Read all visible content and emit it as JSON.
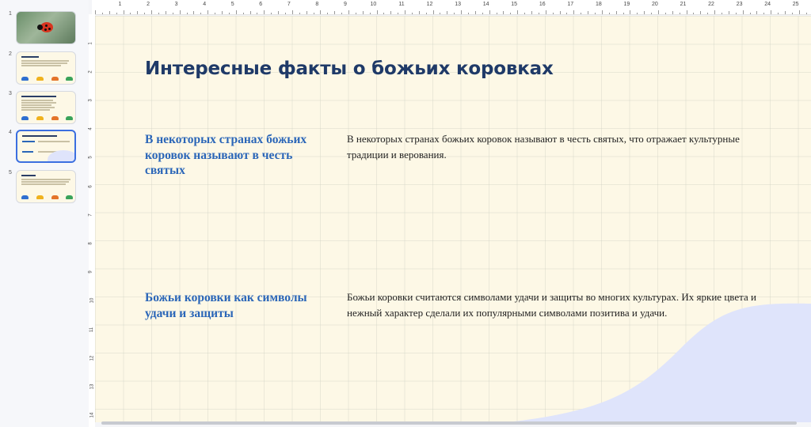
{
  "thumbnails": [
    {
      "number": "1",
      "kind": "photo"
    },
    {
      "number": "2",
      "kind": "text"
    },
    {
      "number": "3",
      "kind": "text"
    },
    {
      "number": "4",
      "kind": "selected"
    },
    {
      "number": "5",
      "kind": "text"
    }
  ],
  "ruler": {
    "top": [
      "1",
      "2",
      "3",
      "4",
      "5",
      "6",
      "7",
      "8",
      "9",
      "10",
      "11",
      "12",
      "13",
      "14",
      "15",
      "16",
      "17",
      "18",
      "19",
      "20",
      "21",
      "22",
      "23",
      "24",
      "25"
    ],
    "left": [
      "1",
      "2",
      "3",
      "4",
      "5",
      "6",
      "7",
      "8",
      "9",
      "10",
      "11",
      "12",
      "13",
      "14"
    ]
  },
  "slide": {
    "title": "Интересные факты о божьих коровках",
    "facts": [
      {
        "heading": "В некоторых странах божьих коровок называют в честь святых",
        "text": "В некоторых странах божьих коровок называют в честь святых, что отражает культурные традиции и верования."
      },
      {
        "heading": "Божьи коровки как символы удачи и защиты",
        "text": "Божьи коровки считаются символами удачи и защиты во многих культурах. Их яркие цвета и нежный характер сделали их популярными символами позитива и удачи."
      }
    ]
  },
  "colors": {
    "slide_background": "#fdf8e6",
    "title": "#1f3a68",
    "heading": "#2b66b8",
    "wave": "#dfe4fb",
    "selection": "#3b6fe0"
  }
}
